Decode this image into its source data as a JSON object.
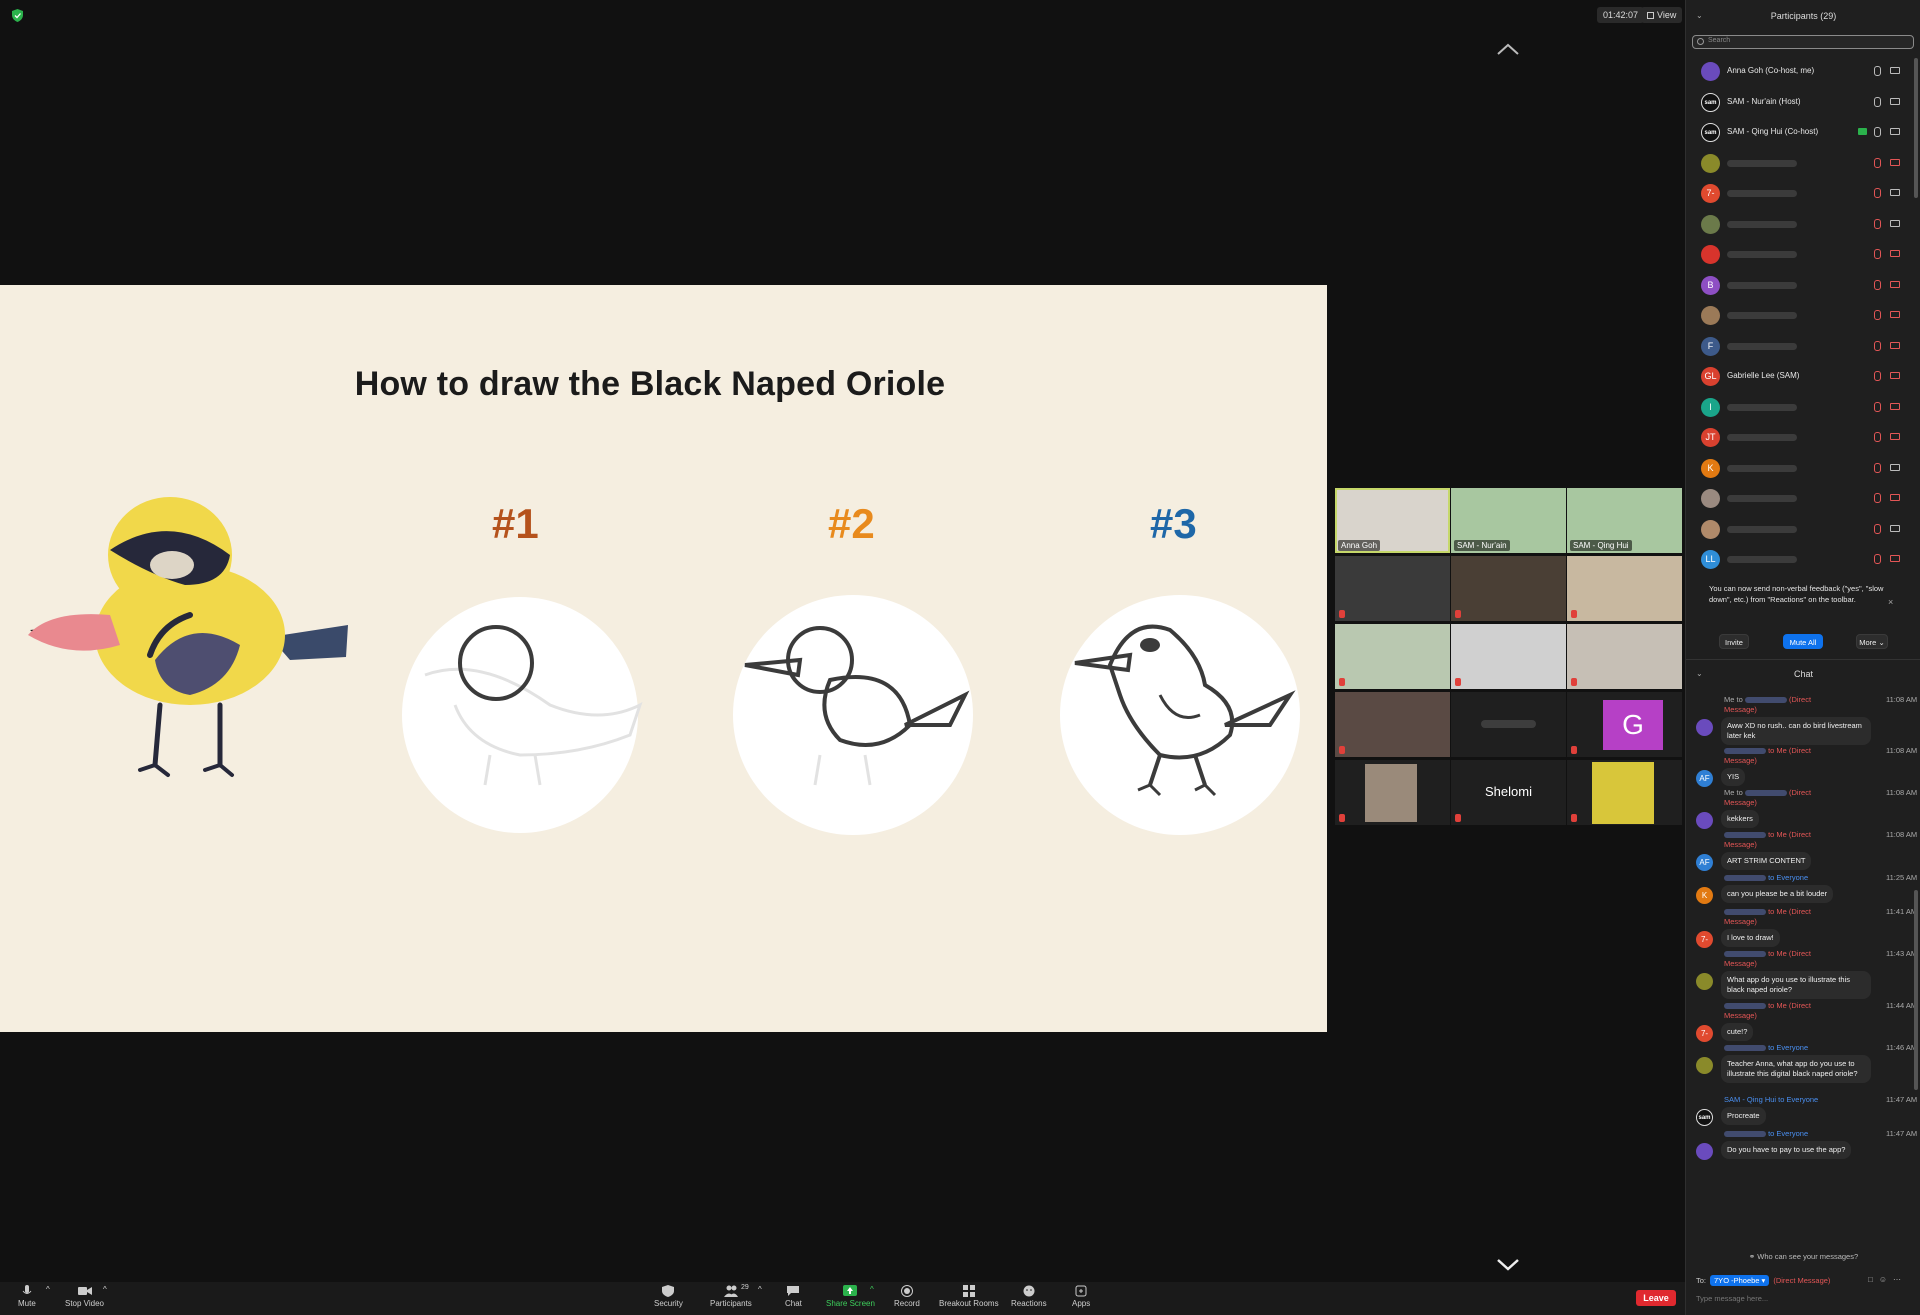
{
  "window": {
    "clock": "01:42:07",
    "view_label": "View"
  },
  "slide": {
    "title": "How to draw the Black Naped Oriole",
    "steps": [
      {
        "label": "#1",
        "color": "#b5521c"
      },
      {
        "label": "#2",
        "color": "#e88a1d"
      },
      {
        "label": "#3",
        "color": "#1e67a8"
      }
    ]
  },
  "video_grid": {
    "tiles": [
      {
        "name": "Anna Goh",
        "active": true
      },
      {
        "name": "SAM - Nur'ain"
      },
      {
        "name": "SAM - Qing Hui"
      },
      {
        "name": ""
      },
      {
        "name": ""
      },
      {
        "name": ""
      },
      {
        "name": ""
      },
      {
        "name": ""
      },
      {
        "name": ""
      },
      {
        "name": ""
      },
      {
        "name": ""
      },
      {
        "name": "",
        "avatar_letter": "G"
      },
      {
        "name": ""
      },
      {
        "name": "Shelomi"
      },
      {
        "name": ""
      }
    ]
  },
  "toolbar": {
    "mute": "Mute",
    "stop_video": "Stop Video",
    "security": "Security",
    "participants": "Participants",
    "participants_count": "29",
    "chat": "Chat",
    "share_screen": "Share Screen",
    "record": "Record",
    "breakout_rooms": "Breakout Rooms",
    "reactions": "Reactions",
    "apps": "Apps",
    "leave": "Leave"
  },
  "participants_panel": {
    "title": "Participants (29)",
    "search_placeholder": "Search",
    "participants": [
      {
        "name": "Anna Goh (Co-host, me)",
        "avatar": "",
        "avatar_color": "#6a4bbd",
        "mic": "on",
        "cam": "on"
      },
      {
        "name": "SAM - Nur'ain (Host)",
        "avatar": "sam",
        "avatar_color": "#111111",
        "mic": "on",
        "cam": "on"
      },
      {
        "name": "SAM - Qing Hui (Co-host)",
        "avatar": "sam",
        "avatar_color": "#111111",
        "mic": "on",
        "cam": "on",
        "sharing": true
      },
      {
        "name": "",
        "avatar": "",
        "avatar_color": "#8a8a2a",
        "mic": "off",
        "cam": "off"
      },
      {
        "name": "",
        "avatar": "7-",
        "avatar_color": "#e04a2f",
        "mic": "off",
        "cam": "on"
      },
      {
        "name": "",
        "avatar": "",
        "avatar_color": "#6b7a4a",
        "mic": "off",
        "cam": "on"
      },
      {
        "name": "",
        "avatar": "",
        "avatar_color": "#d8342c",
        "mic": "off",
        "cam": "off"
      },
      {
        "name": "",
        "avatar": "B",
        "avatar_color": "#8e4fc4",
        "mic": "off",
        "cam": "off"
      },
      {
        "name": "",
        "avatar": "",
        "avatar_color": "#9b7a58",
        "mic": "off",
        "cam": "off"
      },
      {
        "name": "",
        "avatar": "F",
        "avatar_color": "#3d5a8a",
        "mic": "off",
        "cam": "off"
      },
      {
        "name": "Gabrielle Lee (SAM)",
        "avatar": "GL",
        "avatar_color": "#d9412f",
        "mic": "off",
        "cam": "off"
      },
      {
        "name": "",
        "avatar": "I",
        "avatar_color": "#1aa58a",
        "mic": "off",
        "cam": "off"
      },
      {
        "name": "",
        "avatar": "JT",
        "avatar_color": "#d9412f",
        "mic": "off",
        "cam": "off"
      },
      {
        "name": "",
        "avatar": "K",
        "avatar_color": "#e27a12",
        "mic": "off",
        "cam": "on"
      },
      {
        "name": "",
        "avatar": "",
        "avatar_color": "#9a8a80",
        "mic": "off",
        "cam": "off"
      },
      {
        "name": "",
        "avatar": "",
        "avatar_color": "#b08a6a",
        "mic": "off",
        "cam": "on"
      },
      {
        "name": "",
        "avatar": "LL",
        "avatar_color": "#2f8ed8",
        "mic": "off",
        "cam": "off"
      }
    ],
    "notice": "You can now send non-verbal feedback (\"yes\", \"slow down\", etc.) from \"Reactions\" on the toolbar.",
    "invite": "Invite",
    "mute_all": "Mute All",
    "more": "More"
  },
  "chat_panel": {
    "title": "Chat",
    "messages": [
      {
        "header_pre": "Me to",
        "header_post": "(Direct",
        "header_line2": "Message)",
        "time": "11:08 AM",
        "avatar": "",
        "avatar_color": "#6a4bbd",
        "text": "Aww XD no rush.. can do bird livestream later kek"
      },
      {
        "header_pre": "",
        "header_post": "to Me (Direct",
        "header_line2": "Message)",
        "time": "11:08 AM",
        "avatar": "AF",
        "avatar_color": "#2f7fd4",
        "text": "YIS"
      },
      {
        "header_pre": "Me to",
        "header_post": "(Direct",
        "header_line2": "Message)",
        "time": "11:08 AM",
        "avatar": "",
        "avatar_color": "#6a4bbd",
        "text": "kekkers"
      },
      {
        "header_pre": "",
        "header_post": "to Me (Direct",
        "header_line2": "Message)",
        "time": "11:08 AM",
        "avatar": "AF",
        "avatar_color": "#2f7fd4",
        "text": "ART STRIM CONTENT"
      },
      {
        "header_pre": "",
        "header_post": "to Everyone",
        "header_line2": "",
        "time": "11:25 AM",
        "avatar": "K",
        "avatar_color": "#e27a12",
        "text": "can you please be a bit louder",
        "everyone": true
      },
      {
        "header_pre": "",
        "header_post": "to Me (Direct",
        "header_line2": "Message)",
        "time": "11:41 AM",
        "avatar": "7-",
        "avatar_color": "#e04a2f",
        "text": "I love to draw!"
      },
      {
        "header_pre": "",
        "header_post": "to Me (Direct",
        "header_line2": "Message)",
        "time": "11:43 AM",
        "avatar": "",
        "avatar_color": "#8a8a2a",
        "text": "What app do you use to illustrate this black naped oriole?"
      },
      {
        "header_pre": "",
        "header_post": "to Me (Direct",
        "header_line2": "Message)",
        "time": "11:44 AM",
        "avatar": "7-",
        "avatar_color": "#e04a2f",
        "text": "cute!?"
      },
      {
        "header_pre": "",
        "header_post": "to Everyone",
        "header_line2": "",
        "time": "11:46 AM",
        "avatar": "",
        "avatar_color": "#8a8a2a",
        "text": "Teacher Anna, what app do you use to illustrate this digital black naped oriole?",
        "everyone": true
      },
      {
        "header_pre": "SAM - Qing Hui to",
        "header_post": "Everyone",
        "header_line2": "",
        "time": "11:47 AM",
        "avatar": "sam",
        "avatar_color": "#111111",
        "text": "Procreate",
        "everyone": true,
        "named": true
      },
      {
        "header_pre": "",
        "header_post": "to Everyone",
        "header_line2": "",
        "time": "11:47 AM",
        "avatar": "",
        "avatar_color": "#6a4bbd",
        "text": "Do you have to pay to use the app?",
        "everyone": true
      }
    ],
    "who_can_see": "Who can see your messages?",
    "to_label": "To:",
    "to_recipient": "7YO -Phoebe",
    "to_mode": "(Direct Message)",
    "input_placeholder": "Type message here..."
  }
}
